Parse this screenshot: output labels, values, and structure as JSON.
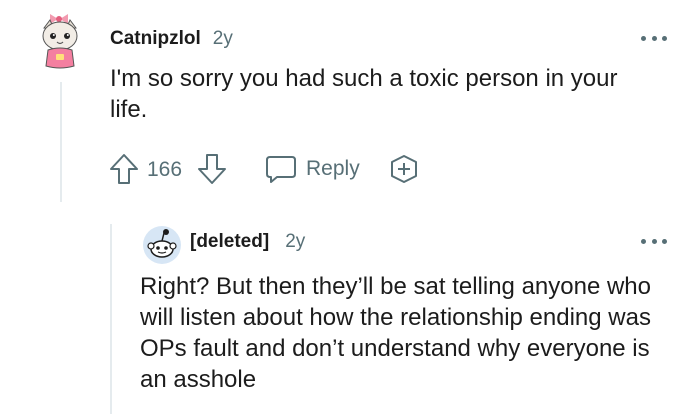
{
  "comment": {
    "username": "Catnipzlol",
    "age": "2y",
    "text": "I'm so sorry you had such a toxic person in your life.",
    "votes": "166",
    "reply_label": "Reply",
    "avatar_icon": "cat-avatar-icon"
  },
  "reply": {
    "username": "[deleted]",
    "age": "2y",
    "text": "Right? But then they’ll be sat telling anyone who will listen about how the relationship ending was OPs fault and don’t understand why everyone is an asshole",
    "avatar_icon": "snoo-avatar-icon"
  },
  "colors": {
    "text": "#1c1c1c",
    "meta": "#576f76",
    "thread": "#e5ebee"
  }
}
